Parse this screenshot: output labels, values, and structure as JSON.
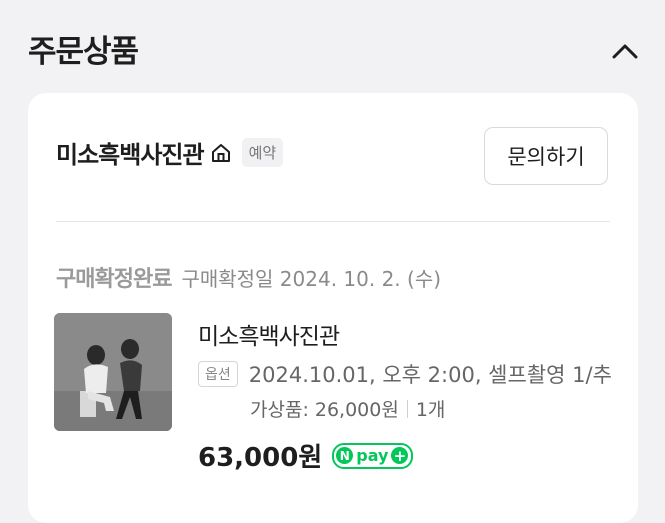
{
  "section": {
    "title": "주문상품",
    "collapse_icon": "chevron-up-icon"
  },
  "store": {
    "name": "미소흑백사진관",
    "home_icon": "home-icon",
    "badge": "예약",
    "inquiry_button": "문의하기"
  },
  "order": {
    "status": "구매확정완료",
    "confirm_date": "구매확정일 2024. 10. 2. (수)",
    "product_name": "미소흑백사진관",
    "option_badge": "옵션",
    "option_text": "2024.10.01, 오후 2:00, 셀프촬영 1/추",
    "addon_label": "가상품: 26,000원",
    "addon_qty": "1개",
    "price": "63,000원",
    "npay_label": "pay",
    "npay_n": "N",
    "npay_plus": "+"
  },
  "colors": {
    "npay_green": "#03c75a",
    "status_gray": "#9a9a9a",
    "background": "#f2f2f4"
  }
}
